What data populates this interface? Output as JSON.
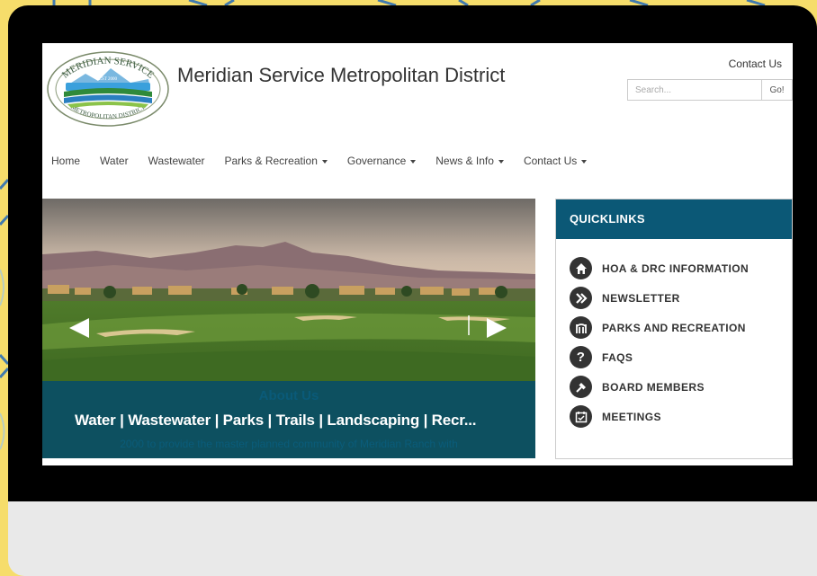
{
  "site": {
    "title": "Meridian Service Metropolitan District",
    "logo_top_text": "MERIDIAN SERVICE",
    "logo_est_text": "EST 2000",
    "logo_bottom_text": "METROPOLITAN DISTRICT"
  },
  "header": {
    "contact_link": "Contact Us",
    "search_placeholder": "Search...",
    "search_button": "Go!"
  },
  "nav": {
    "items": [
      {
        "label": "Home",
        "dropdown": false
      },
      {
        "label": "Water",
        "dropdown": false
      },
      {
        "label": "Wastewater",
        "dropdown": false
      },
      {
        "label": "Parks & Recreation",
        "dropdown": true
      },
      {
        "label": "Governance",
        "dropdown": true
      },
      {
        "label": "News & Info",
        "dropdown": true
      },
      {
        "label": "Contact Us",
        "dropdown": true
      }
    ]
  },
  "slider": {
    "caption_title": "About Us",
    "caption_main": "Water | Wastewater | Parks | Trails | Landscaping | Recr...",
    "caption_sub": "2000 to provide the master planned community of Meridian Ranch with"
  },
  "quicklinks": {
    "heading": "QUICKLINKS",
    "items": [
      {
        "label": "HOA & DRC INFORMATION",
        "icon": "home-icon"
      },
      {
        "label": "NEWSLETTER",
        "icon": "double-chevron-right-icon"
      },
      {
        "label": "PARKS AND RECREATION",
        "icon": "park-gate-icon"
      },
      {
        "label": "FAQS",
        "icon": "question-icon"
      },
      {
        "label": "BOARD MEMBERS",
        "icon": "gavel-icon"
      },
      {
        "label": "MEETINGS",
        "icon": "calendar-check-icon"
      }
    ]
  },
  "colors": {
    "background": "#f6dd6b",
    "accent_teal": "#0b5876",
    "device_frame": "#000000"
  }
}
